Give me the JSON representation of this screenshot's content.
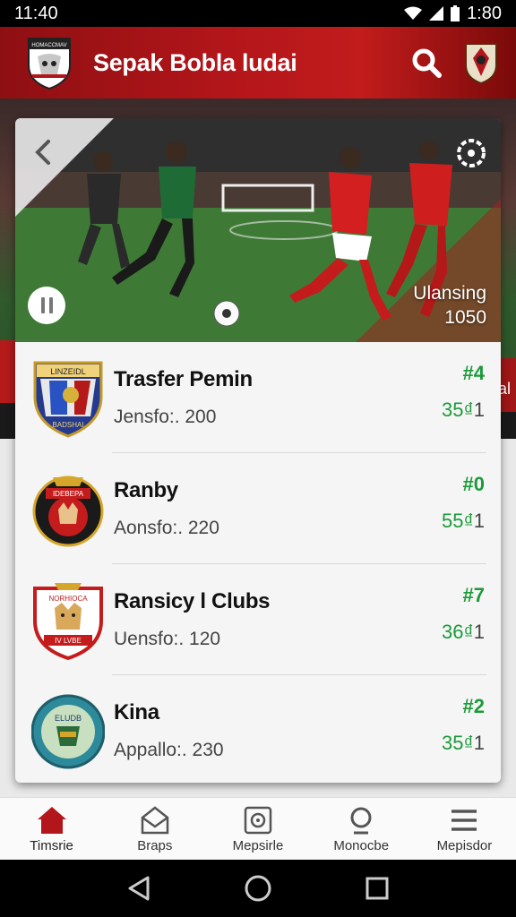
{
  "status_bar": {
    "time": "11:40",
    "clock_right": "1:80"
  },
  "app_bar": {
    "title": "Sepak Bobla ludai",
    "logo_text": "HOMACCMAV"
  },
  "hero": {
    "caption_line1": "Ulansing",
    "caption_line2": "1050"
  },
  "side_text": "al",
  "clubs": [
    {
      "name": "Trasfer Pemin",
      "sub": "Jensfo:. 200",
      "rank": "#4",
      "score_main": "35₫",
      "score_tail": "1",
      "logo_text": "LINZEIDL",
      "logo_bottom": "BADSHAI"
    },
    {
      "name": "Ranby",
      "sub": "Aonsfo:. 220",
      "rank": "#0",
      "score_main": "55₫",
      "score_tail": "1",
      "logo_text": "IDEBEPA",
      "logo_bottom": ""
    },
    {
      "name": "Ransicy l Clubs",
      "sub": "Uensfo:. 120",
      "rank": "#7",
      "score_main": "36₫",
      "score_tail": "1",
      "logo_text": "NORHIOCA",
      "logo_bottom": "IV LVBE"
    },
    {
      "name": "Kina",
      "sub": "Appallo:. 230",
      "rank": "#2",
      "score_main": "35₫",
      "score_tail": "1",
      "logo_text": "ELUDB",
      "logo_bottom": ""
    }
  ],
  "bottom_nav": [
    {
      "label": "Timsrie",
      "icon": "home-icon"
    },
    {
      "label": "Braps",
      "icon": "inbox-icon"
    },
    {
      "label": "Mepsirle",
      "icon": "film-icon"
    },
    {
      "label": "Monocbe",
      "icon": "search-icon"
    },
    {
      "label": "Mepisdor",
      "icon": "menu-icon"
    }
  ],
  "colors": {
    "brand_red": "#b3161a",
    "score_green": "#1c9a3a"
  }
}
